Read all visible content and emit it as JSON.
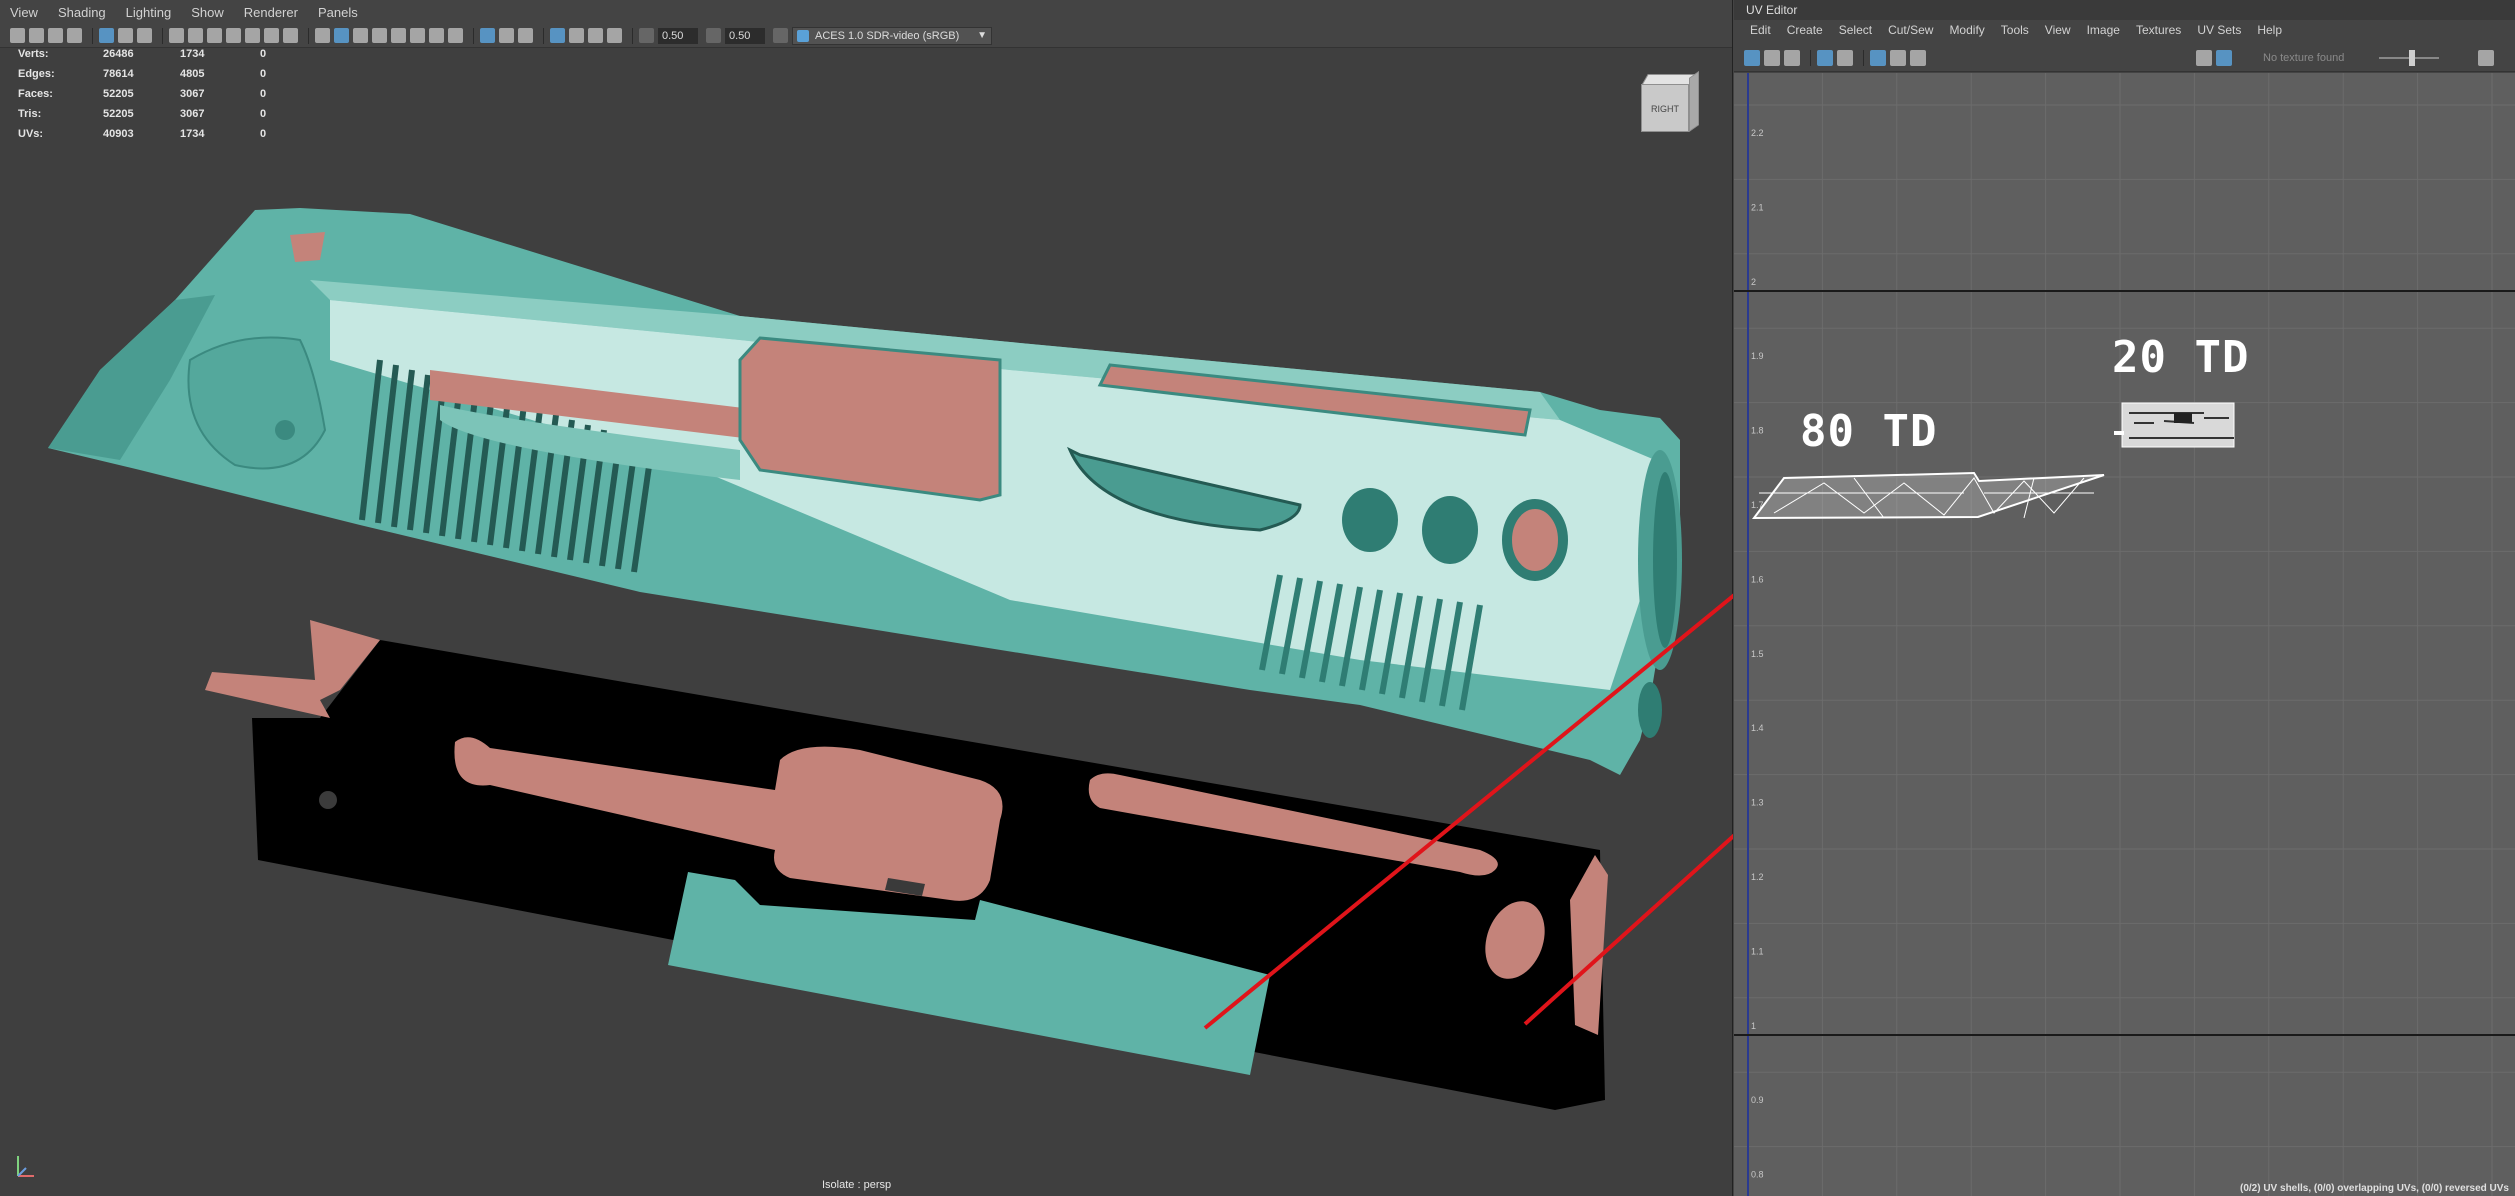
{
  "viewport": {
    "menu": [
      "View",
      "Shading",
      "Lighting",
      "Show",
      "Renderer",
      "Panels"
    ],
    "toolbar": {
      "field1": "0.50",
      "field2": "0.50",
      "color_space": "ACES 1.0 SDR-video (sRGB)"
    },
    "hud": {
      "rows": [
        {
          "label": "Verts:",
          "c1": "26486",
          "c2": "1734",
          "c3": "0"
        },
        {
          "label": "Edges:",
          "c1": "78614",
          "c2": "4805",
          "c3": "0"
        },
        {
          "label": "Faces:",
          "c1": "52205",
          "c2": "3067",
          "c3": "0"
        },
        {
          "label": "Tris:",
          "c1": "52205",
          "c2": "3067",
          "c3": "0"
        },
        {
          "label": "UVs:",
          "c1": "40903",
          "c2": "1734",
          "c3": "0"
        }
      ]
    },
    "viewcube_label": "RIGHT",
    "footer": "Isolate : persp",
    "colors": {
      "teal": "#5fb3a7",
      "teal_light": "#bfe3dc",
      "salmon": "#c4837a",
      "black": "#000000",
      "background": "#3f3f3f",
      "red_line": "#e0141a"
    }
  },
  "uv_editor": {
    "title": "UV Editor",
    "menu": [
      "Edit",
      "Create",
      "Select",
      "Cut/Sew",
      "Modify",
      "Tools",
      "View",
      "Image",
      "Textures",
      "UV Sets",
      "Help"
    ],
    "no_texture": "No texture found",
    "status": "(0/2) UV shells, (0/0) overlapping UVs, (0/0) reversed UVs",
    "labels": {
      "left": "80 TD",
      "right": "20 TD"
    },
    "axis_ticks": [
      "2.2",
      "2.1",
      "2",
      "1.9",
      "1.8",
      "1.7",
      "1.6",
      "1.5",
      "1.4",
      "1.3",
      "1.2",
      "1.1",
      "1",
      "0.9",
      "0.8"
    ]
  }
}
